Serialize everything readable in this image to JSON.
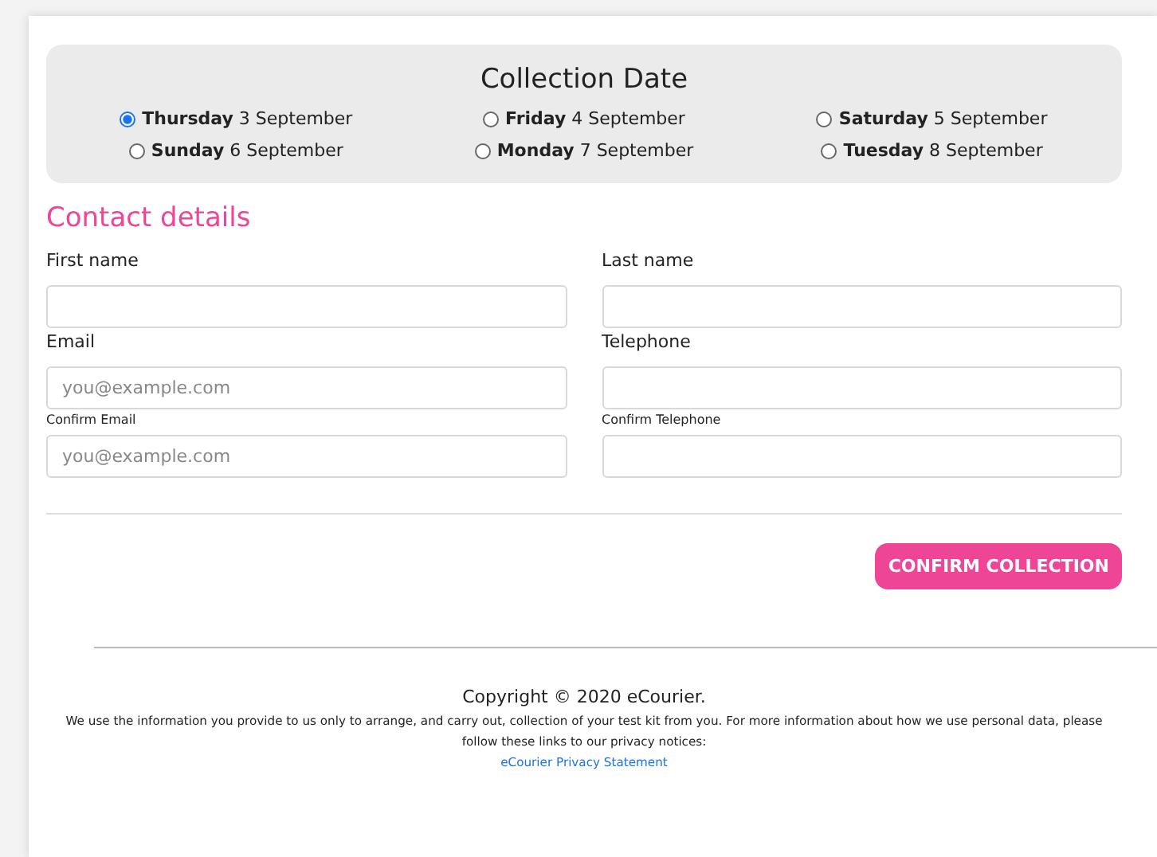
{
  "collection": {
    "title": "Collection Date",
    "options": [
      {
        "day": "Thursday",
        "date": "3 September",
        "selected": true
      },
      {
        "day": "Friday",
        "date": "4 September",
        "selected": false
      },
      {
        "day": "Saturday",
        "date": "5 September",
        "selected": false
      },
      {
        "day": "Sunday",
        "date": "6 September",
        "selected": false
      },
      {
        "day": "Monday",
        "date": "7 September",
        "selected": false
      },
      {
        "day": "Tuesday",
        "date": "8 September",
        "selected": false
      }
    ]
  },
  "contact": {
    "heading": "Contact details",
    "fields": [
      {
        "label": "First name",
        "kind": "main"
      },
      {
        "label": "Last name",
        "kind": "main"
      },
      {
        "label": "Email",
        "placeholder": "you@example.com",
        "kind": "main"
      },
      {
        "label": "Telephone",
        "kind": "main"
      },
      {
        "label": "Confirm Email",
        "placeholder": "you@example.com",
        "kind": "confirm"
      },
      {
        "label": "Confirm Telephone",
        "kind": "confirm"
      }
    ]
  },
  "confirm_button": "CONFIRM COLLECTION",
  "footer": {
    "copyright": "Copyright © 2020 eCourier.",
    "notice": "We use the information you provide to us only to arrange, and carry out, collection of your test kit from you. For more information about how we use personal data, please follow these links to our privacy notices:",
    "link": "eCourier Privacy Statement"
  }
}
